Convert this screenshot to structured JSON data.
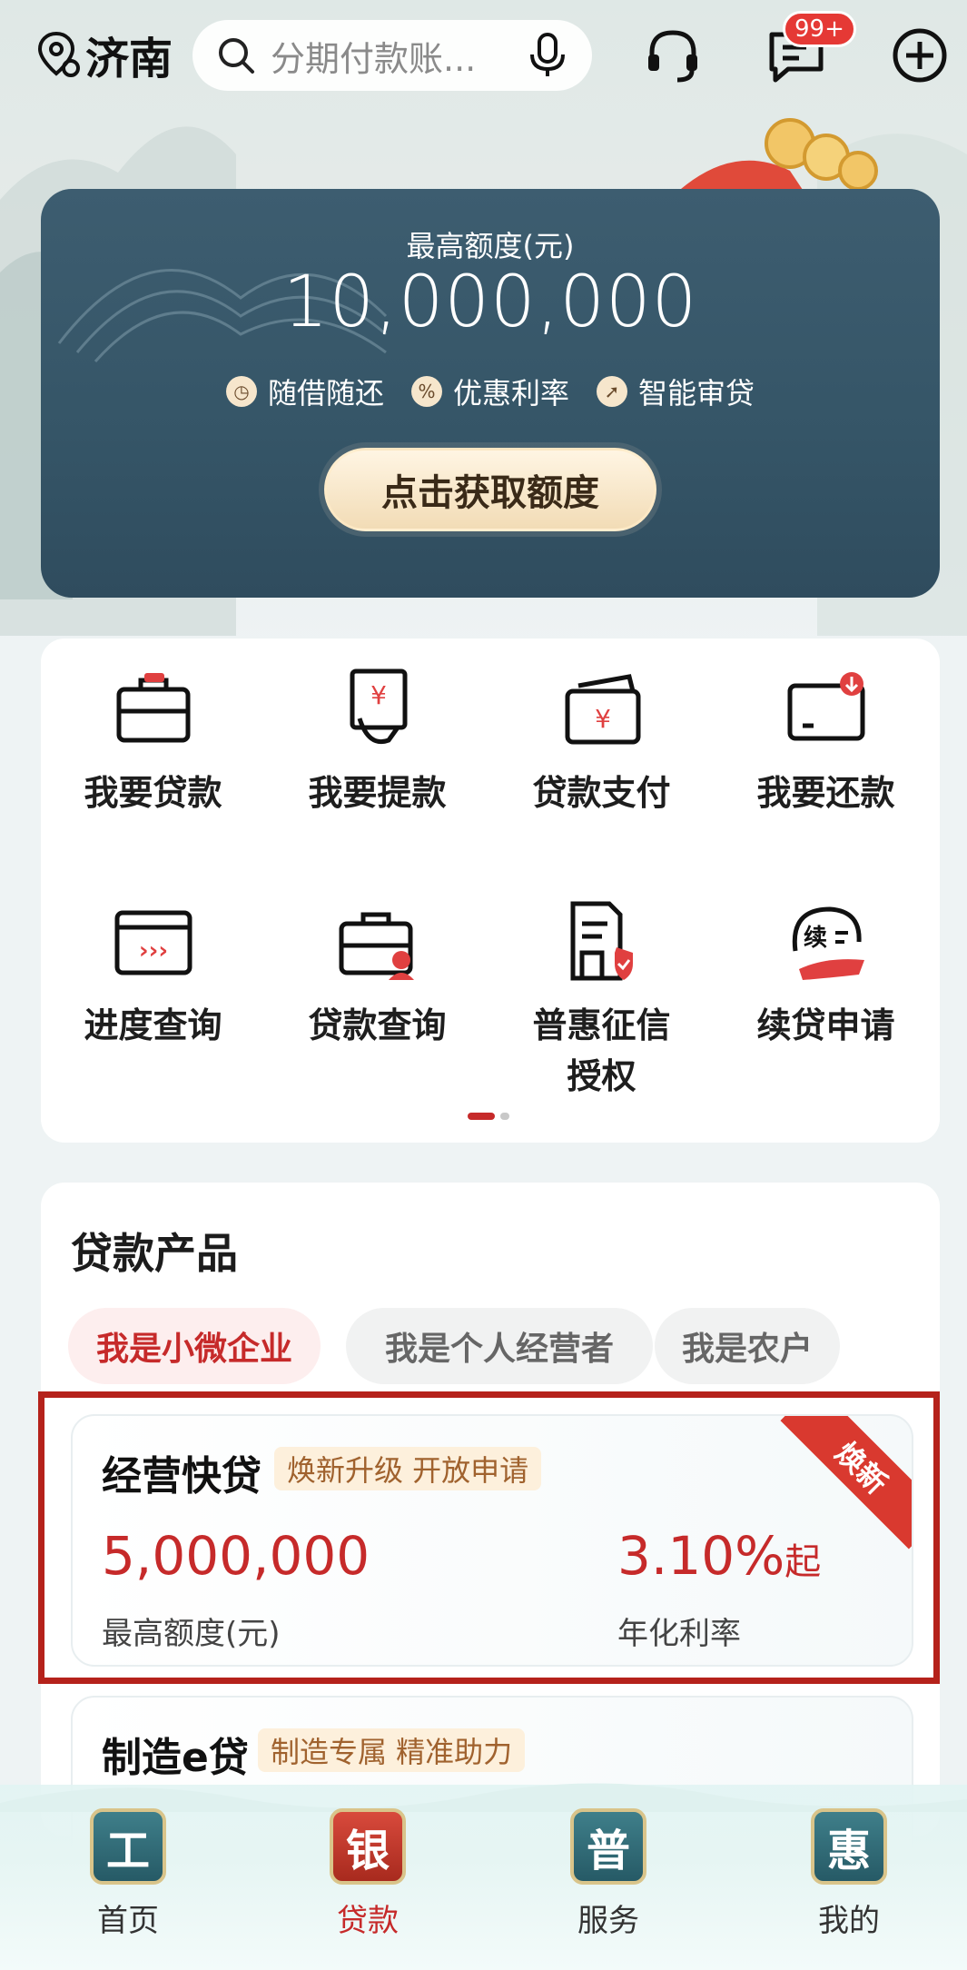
{
  "header": {
    "city": "济南",
    "search_placeholder": "分期付款账...",
    "message_badge": "99+"
  },
  "hero": {
    "label": "最高额度(元)",
    "amount": "10,000,000",
    "features": [
      {
        "icon": "clock-icon",
        "text": "随借随还"
      },
      {
        "icon": "percent-icon",
        "text": "优惠利率"
      },
      {
        "icon": "rocket-icon",
        "text": "智能审贷"
      }
    ],
    "cta": "点击获取额度"
  },
  "menu": {
    "items": [
      {
        "label": "我要贷款",
        "icon": "briefcase-icon"
      },
      {
        "label": "我要提款",
        "icon": "withdraw-icon"
      },
      {
        "label": "贷款支付",
        "icon": "wallet-icon"
      },
      {
        "label": "我要还款",
        "icon": "repay-card-icon"
      },
      {
        "label": "进度查询",
        "icon": "progress-icon"
      },
      {
        "label": "贷款查询",
        "icon": "loan-query-icon"
      },
      {
        "label": "普惠征信",
        "label2": "授权",
        "icon": "credit-auth-icon"
      },
      {
        "label": "续贷申请",
        "icon": "renew-icon"
      }
    ],
    "pager": {
      "current": 1,
      "total": 2
    }
  },
  "products": {
    "title": "贷款产品",
    "chips": [
      "我是小微企业",
      "我是个人经营者",
      "我是农户"
    ],
    "active_chip": 0,
    "cards": [
      {
        "name": "经营快贷",
        "tag": "焕新升级 开放申请",
        "ribbon": "焕新",
        "amount": "5,000,000",
        "amount_label": "最高额度(元)",
        "rate": "3.10%",
        "rate_suffix": "起",
        "rate_label": "年化利率"
      },
      {
        "name": "制造e贷",
        "tag": "制造专属 精准助力"
      }
    ]
  },
  "tabbar": {
    "tabs": [
      {
        "glyph": "工",
        "label": "首页",
        "active": false
      },
      {
        "glyph": "银",
        "label": "贷款",
        "active": true
      },
      {
        "glyph": "普",
        "label": "服务",
        "active": false
      },
      {
        "glyph": "惠",
        "label": "我的",
        "active": false
      }
    ]
  },
  "colors": {
    "accent_red": "#c62a2a",
    "hero_blue": "#3d5d70",
    "highlight_border": "#b5221b"
  }
}
